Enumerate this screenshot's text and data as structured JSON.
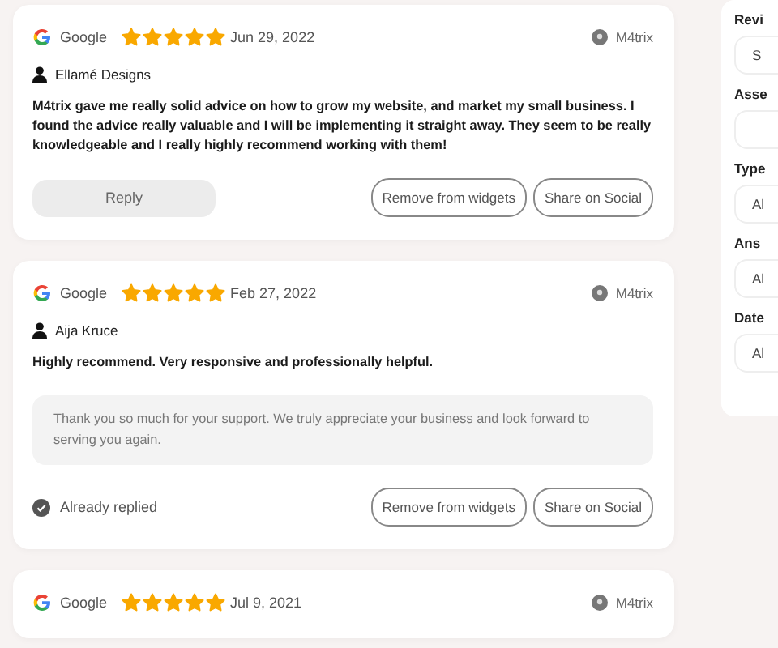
{
  "reviews": [
    {
      "source": "Google",
      "stars": 5,
      "date": "Jun 29, 2022",
      "location": "M4trix",
      "author": "Ellamé Designs",
      "text": "M4trix gave me really solid advice on how to grow my website, and market my small business. I found the advice really valuable and I will be implementing it straight away. They seem to be really knowledgeable and I really highly recommend working with them!",
      "status": {
        "kind": "reply",
        "label": "Reply"
      },
      "actions": [
        "Remove from widgets",
        "Share on Social"
      ]
    },
    {
      "source": "Google",
      "stars": 5,
      "date": "Feb 27, 2022",
      "location": "M4trix",
      "author": "Aija Kruce",
      "text": "Highly recommend. Very responsive and professionally helpful.",
      "response": "Thank you so much for your support. We truly appreciate your business and look forward to serving you again.",
      "status": {
        "kind": "replied",
        "label": "Already replied"
      },
      "actions": [
        "Remove from widgets",
        "Share on Social"
      ]
    },
    {
      "source": "Google",
      "stars": 5,
      "date": "Jul 9, 2021",
      "location": "M4trix"
    }
  ],
  "filters": [
    {
      "label": "Revi",
      "value": "S"
    },
    {
      "label": "Asse"
    },
    {
      "label": "Type",
      "value": "Al"
    },
    {
      "label": "Ans",
      "value": "Al"
    },
    {
      "label": "Date",
      "value": "Al"
    }
  ]
}
